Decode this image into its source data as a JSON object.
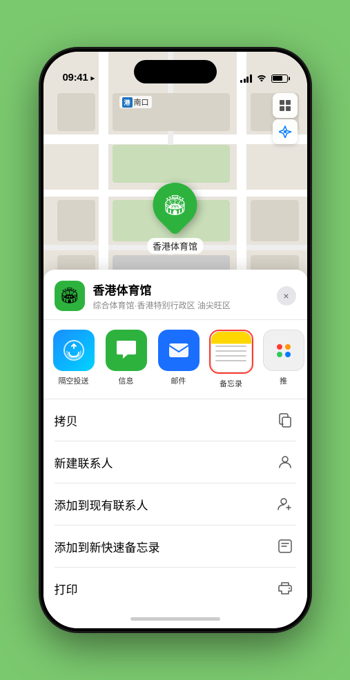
{
  "status_bar": {
    "time": "09:41",
    "location_arrow": "▶"
  },
  "map": {
    "label_south_entrance": "南口",
    "subway_line": "港",
    "venue_name": "香港体育馆",
    "pin_label": "香港体育馆"
  },
  "map_controls": {
    "layers_icon": "🗺",
    "location_icon": "➤"
  },
  "location_card": {
    "name": "香港体育馆",
    "subtitle": "综合体育馆·香港特别行政区 油尖旺区",
    "close_label": "×"
  },
  "share_apps": [
    {
      "id": "airdrop",
      "label": "隔空投送"
    },
    {
      "id": "messages",
      "label": "信息"
    },
    {
      "id": "mail",
      "label": "邮件"
    },
    {
      "id": "notes",
      "label": "备忘录",
      "selected": true
    },
    {
      "id": "more",
      "label": "推"
    }
  ],
  "actions": [
    {
      "label": "拷贝",
      "icon": "copy"
    },
    {
      "label": "新建联系人",
      "icon": "person"
    },
    {
      "label": "添加到现有联系人",
      "icon": "person-add"
    },
    {
      "label": "添加到新快速备忘录",
      "icon": "note"
    },
    {
      "label": "打印",
      "icon": "printer"
    }
  ]
}
